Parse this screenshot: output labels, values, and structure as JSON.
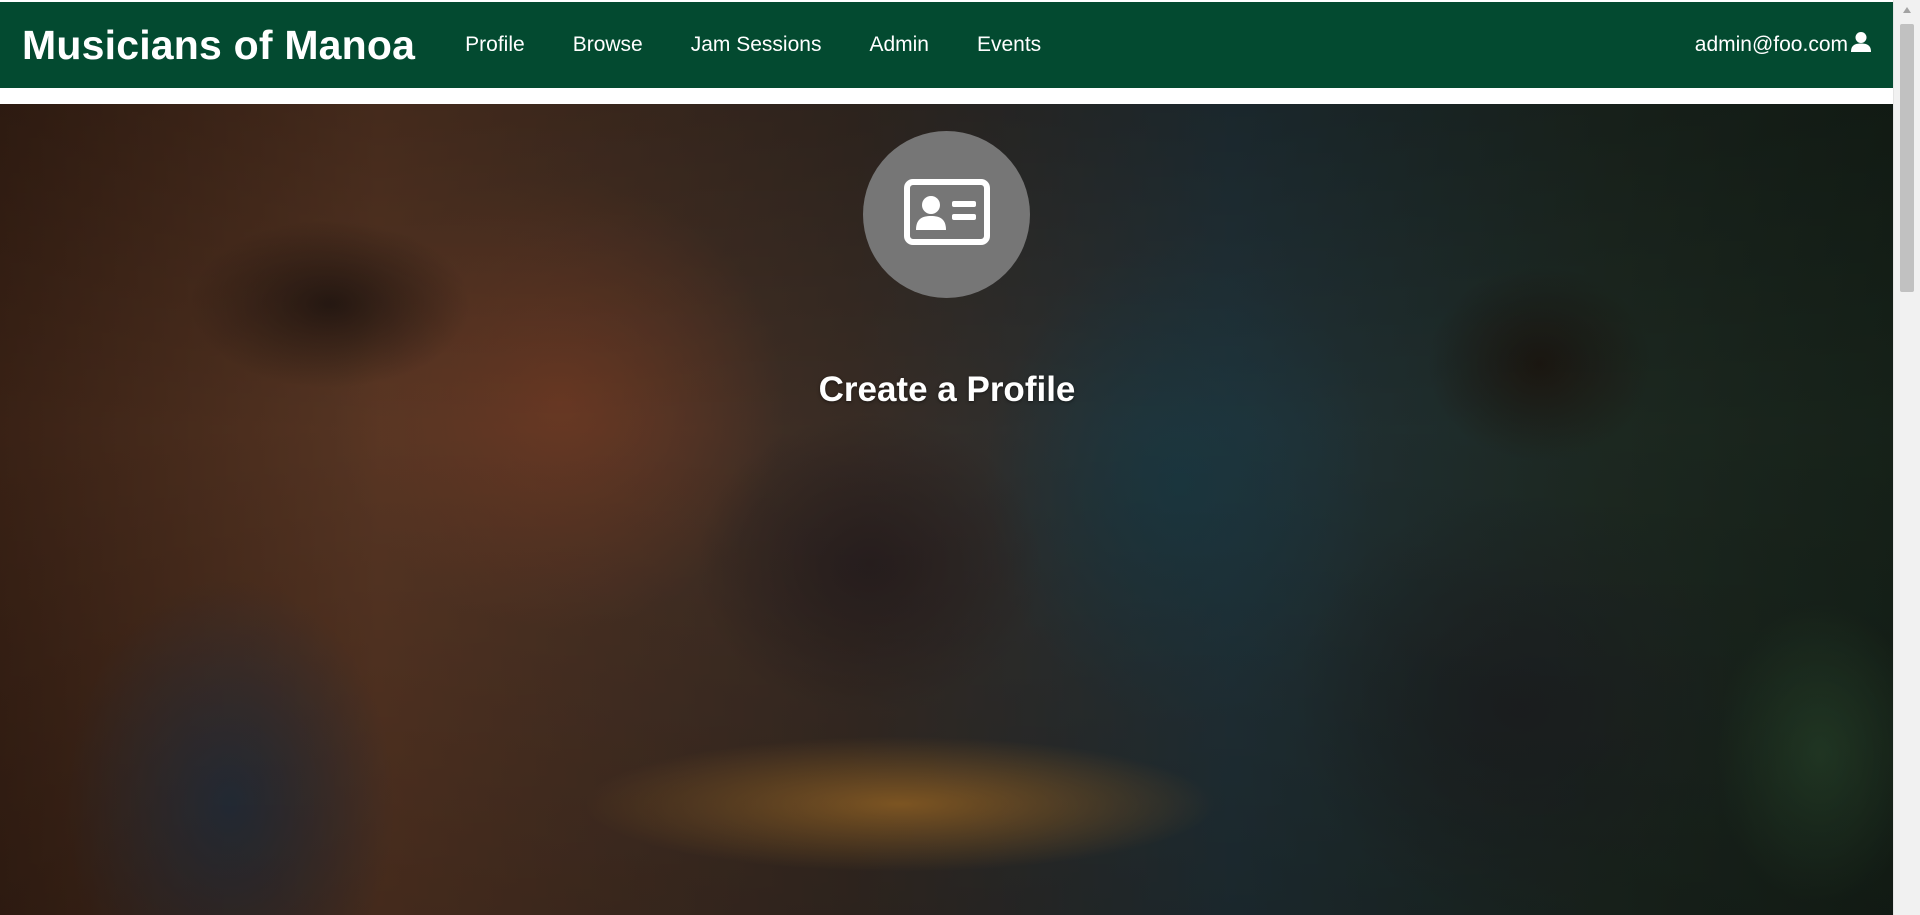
{
  "navbar": {
    "brand": "Musicians of Manoa",
    "links": [
      {
        "label": "Profile"
      },
      {
        "label": "Browse"
      },
      {
        "label": "Jam Sessions"
      },
      {
        "label": "Admin"
      },
      {
        "label": "Events"
      }
    ],
    "user": {
      "email": "admin@foo.com",
      "icon": "user-icon"
    },
    "background_color": "#034a30"
  },
  "hero": {
    "title": "Create a Profile",
    "icon": "id-card-icon",
    "icon_circle_color": "#767676"
  }
}
